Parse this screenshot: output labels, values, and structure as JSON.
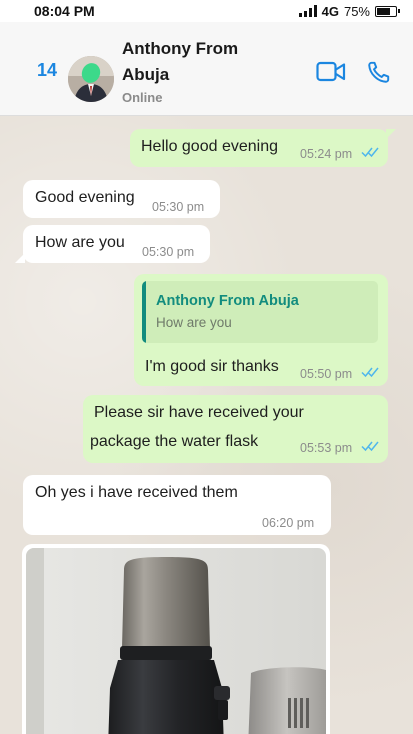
{
  "status_bar": {
    "time": "08:04 PM",
    "network": "4G",
    "battery": "75%",
    "battery_level": 0.75
  },
  "header": {
    "unread_count": "14",
    "contact_name": "Anthony From Abuja",
    "contact_status": "Online",
    "icons": [
      "video-call-icon",
      "voice-call-icon"
    ],
    "accent_color": "#1b86e0"
  },
  "messages": [
    {
      "direction": "outgoing",
      "text": "Hello good evening",
      "time": "05:24 pm",
      "read": true
    },
    {
      "direction": "incoming",
      "text": "Good evening",
      "time": "05:30 pm"
    },
    {
      "direction": "incoming",
      "text": "How are you",
      "time": "05:30 pm"
    },
    {
      "direction": "outgoing",
      "quote_author": "Anthony From Abuja",
      "quote_text": "How are you",
      "text": "I'm good sir thanks",
      "time": "05:50 pm",
      "read": true
    },
    {
      "direction": "outgoing",
      "text_lines": [
        "Please sir have received your",
        "package the water flask"
      ],
      "time": "05:53 pm",
      "read": true
    },
    {
      "direction": "incoming",
      "text": "Oh yes i have received them",
      "time": "06:20 pm"
    },
    {
      "direction": "incoming",
      "type": "image",
      "image_description": "water-flask-photo"
    }
  ],
  "colors": {
    "outgoing_bubble": "#dcf8c6",
    "incoming_bubble": "#ffffff",
    "read_tick": "#4fb6ec",
    "quote_author": "#128c7e"
  }
}
